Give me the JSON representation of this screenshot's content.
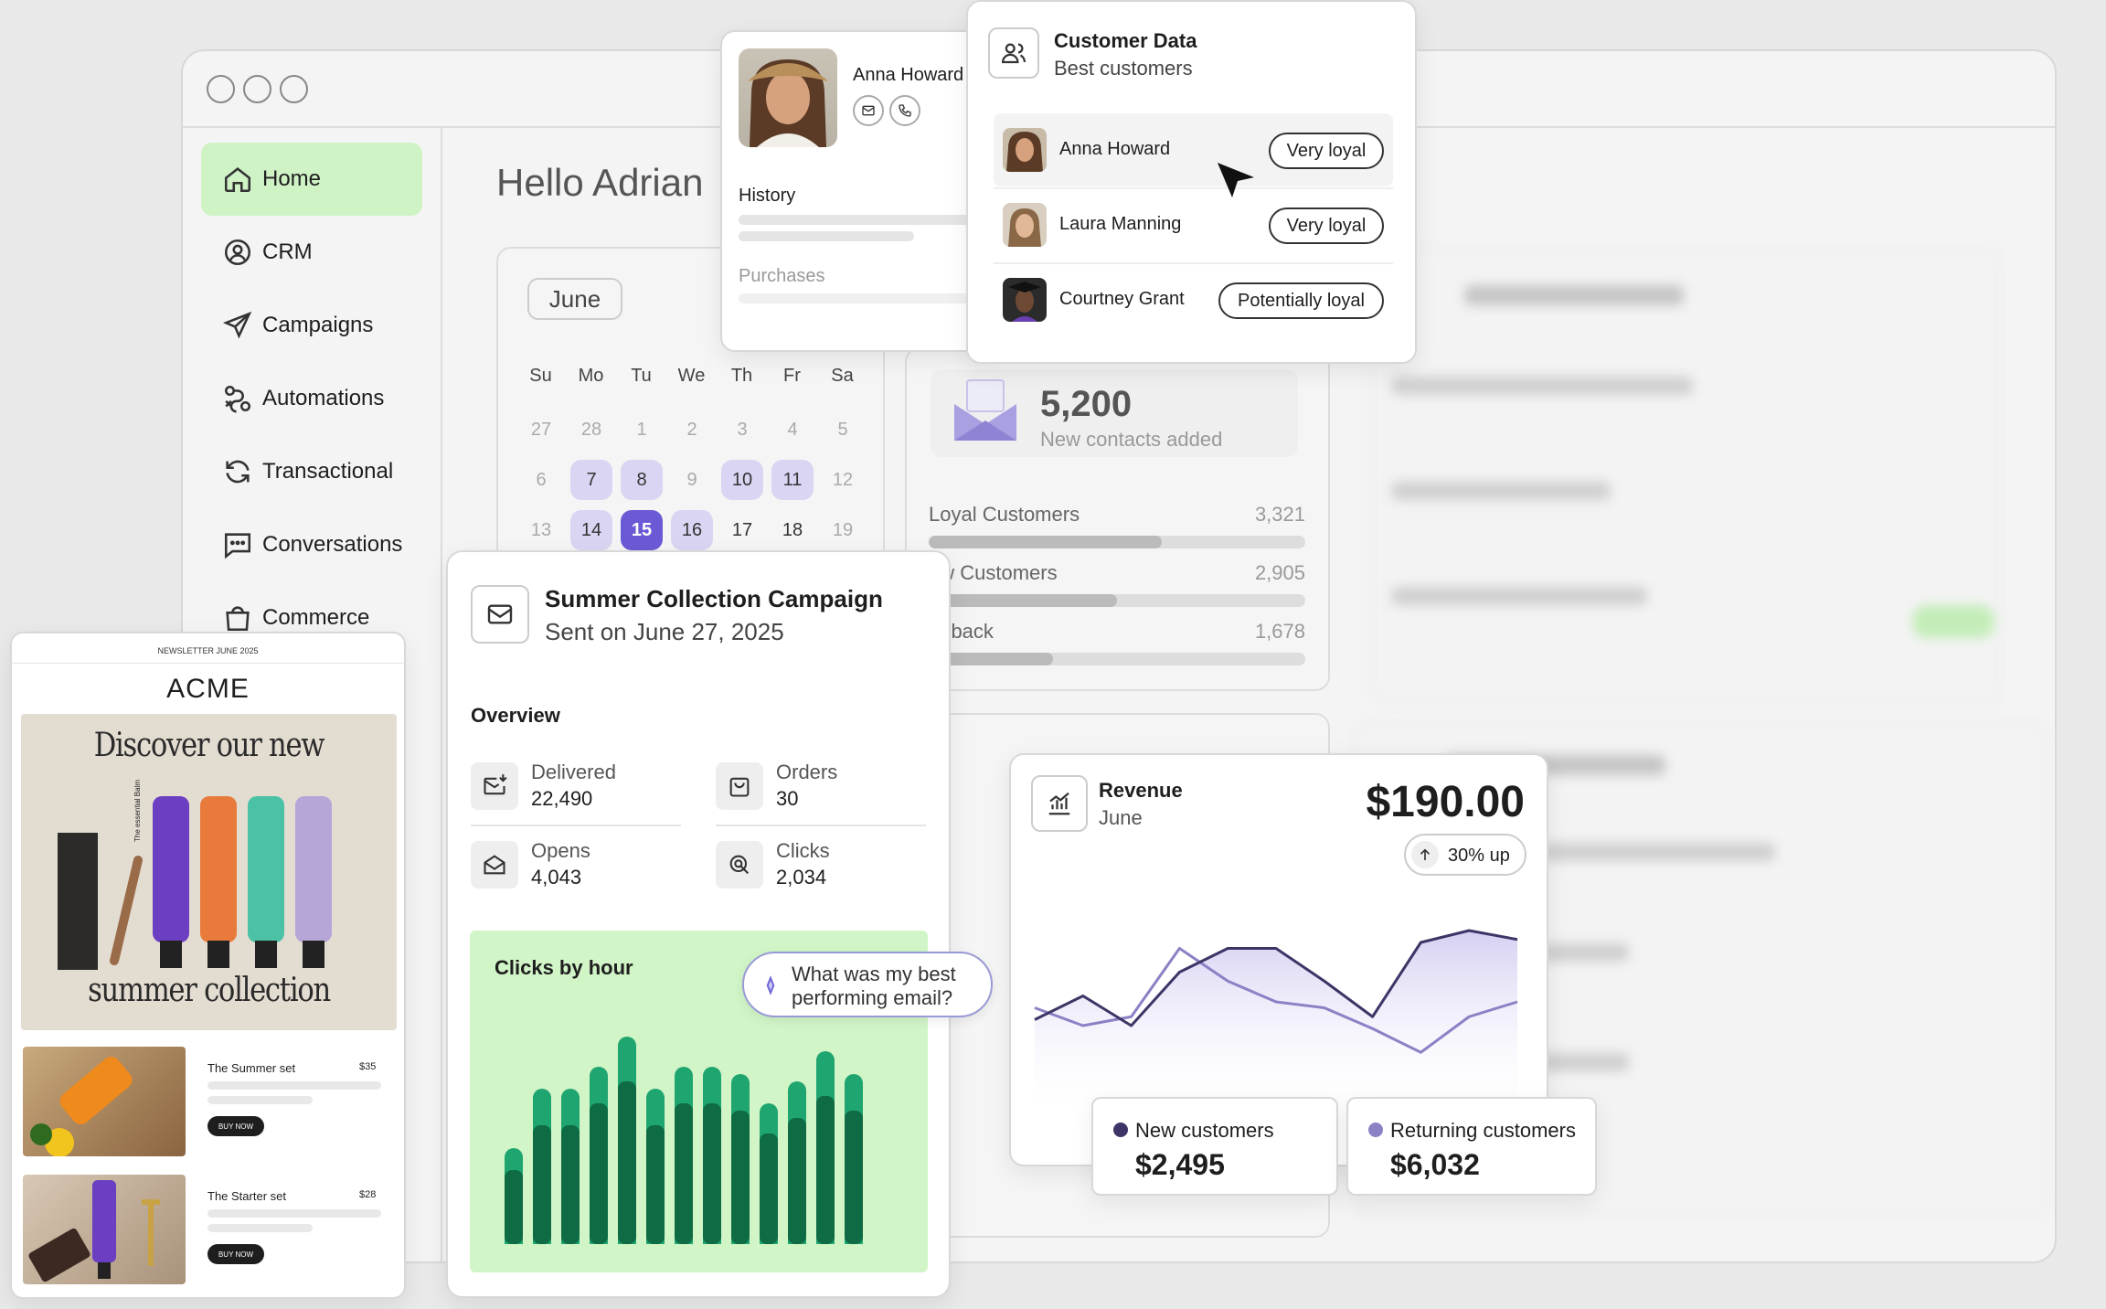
{
  "app": {
    "greeting": "Hello Adrian"
  },
  "sidebar": {
    "items": [
      {
        "label": "Home",
        "icon": "home-icon",
        "active": true
      },
      {
        "label": "CRM",
        "icon": "user-circle-icon"
      },
      {
        "label": "Campaigns",
        "icon": "send-icon"
      },
      {
        "label": "Automations",
        "icon": "automation-icon"
      },
      {
        "label": "Transactional",
        "icon": "refresh-icon"
      },
      {
        "label": "Conversations",
        "icon": "chat-icon"
      },
      {
        "label": "Commerce",
        "icon": "bag-icon"
      }
    ]
  },
  "calendar": {
    "month": "June",
    "weekdays": [
      "Su",
      "Mo",
      "Tu",
      "We",
      "Th",
      "Fr",
      "Sa"
    ],
    "rows": [
      [
        "27",
        "28",
        "1",
        "2",
        "3",
        "4",
        "5"
      ],
      [
        "6",
        "7",
        "8",
        "9",
        "10",
        "11",
        "12"
      ],
      [
        "13",
        "14",
        "15",
        "16",
        "17",
        "18",
        "19"
      ]
    ]
  },
  "profile": {
    "name": "Anna Howard",
    "history_label": "History",
    "purchases_label": "Purchases"
  },
  "customer_data": {
    "title": "Customer Data",
    "subtitle": "Best customers",
    "customers": [
      {
        "name": "Anna Howard",
        "badge": "Very loyal"
      },
      {
        "name": "Laura Manning",
        "badge": "Very loyal"
      },
      {
        "name": "Courtney Grant",
        "badge": "Potentially loyal"
      }
    ]
  },
  "contacts": {
    "count": "5,200",
    "label": "New contacts added",
    "segments": [
      {
        "label": "Loyal Customers",
        "value": "3,321",
        "fill": 0.62
      },
      {
        "label": "ew Customers",
        "value": "2,905",
        "fill": 0.5
      },
      {
        "label": "in-back",
        "value": "1,678",
        "fill": 0.33
      }
    ]
  },
  "campaign": {
    "title": "Summer Collection Campaign",
    "subtitle": "Sent on June 27, 2025",
    "overview_label": "Overview",
    "stats": [
      {
        "label": "Delivered",
        "value": "22,490",
        "icon": "mail-in-icon"
      },
      {
        "label": "Orders",
        "value": "30",
        "icon": "bag-icon"
      },
      {
        "label": "Opens",
        "value": "4,043",
        "icon": "mail-open-icon"
      },
      {
        "label": "Clicks",
        "value": "2,034",
        "icon": "click-icon"
      }
    ],
    "chart_title": "Clicks by hour",
    "ai_prompt": "What was my best performing email?"
  },
  "chart_data": [
    {
      "type": "bar",
      "title": "Clicks by hour",
      "series": [
        {
          "values": [
            10,
            16,
            16,
            19,
            22,
            16,
            19,
            19,
            18,
            15,
            17,
            20,
            18
          ]
        },
        {
          "values": [
            13,
            21,
            21,
            24,
            28,
            21,
            24,
            24,
            23,
            19,
            22,
            26,
            23
          ]
        }
      ]
    },
    {
      "type": "line",
      "title": "Revenue",
      "x": [
        1,
        2,
        3,
        4,
        5,
        6,
        7,
        8,
        9,
        10,
        11,
        12
      ],
      "series": [
        {
          "name": "New customers",
          "color": "#3f3466",
          "values": [
            34,
            42,
            32,
            50,
            58,
            58,
            47,
            35,
            60,
            64,
            61
          ]
        },
        {
          "name": "Returning customers",
          "color": "#8b81c5",
          "values": [
            38,
            32,
            35,
            58,
            47,
            40,
            38,
            31,
            23,
            35,
            40
          ]
        }
      ]
    }
  ],
  "newsletter": {
    "header": "NEWSLETTER JUNE 2025",
    "brand": "ACME",
    "hero_top": "Discover our new",
    "hero_bottom": "summer collection",
    "products": [
      {
        "name": "The Summer set",
        "price": "$35",
        "cta": "BUY NOW"
      },
      {
        "name": "The Starter set",
        "price": "$28",
        "cta": "BUY NOW"
      }
    ],
    "tube_label": "The essential Balm"
  },
  "revenue": {
    "title": "Revenue",
    "period": "June",
    "amount": "$190.00",
    "change": "30% up",
    "legend": [
      {
        "label": "New customers",
        "value": "$2,495",
        "color": "#3f3466"
      },
      {
        "label": "Returning customers",
        "value": "$6,032",
        "color": "#8b81c5"
      }
    ]
  },
  "colors": {
    "accent_green": "#d2f5c8",
    "calendar_highlight": "#d9d5f3",
    "calendar_selected": "#6b5ad6",
    "chart_light": "#1fa56f",
    "chart_dark": "#0e6b43"
  }
}
